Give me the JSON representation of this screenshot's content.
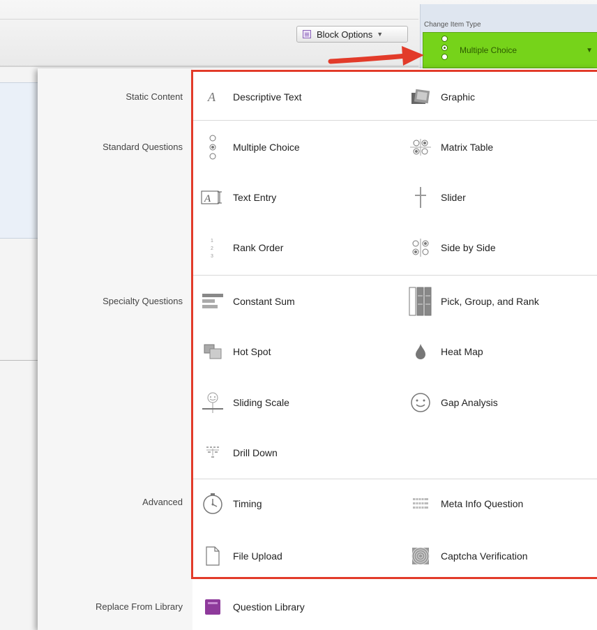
{
  "toolbar": {
    "block_options_label": "Block Options"
  },
  "change_item_type": {
    "label": "Change Item Type",
    "selected_value": "Multiple Choice",
    "accent_color": "#76d31a"
  },
  "categories": {
    "static": "Static Content",
    "standard": "Standard Questions",
    "specialty": "Specialty Questions",
    "advanced": "Advanced",
    "library": "Replace From Library"
  },
  "items": {
    "descriptive_text": {
      "label": "Descriptive Text",
      "icon": "descriptive-text-icon"
    },
    "graphic": {
      "label": "Graphic",
      "icon": "graphic-icon"
    },
    "multiple_choice": {
      "label": "Multiple Choice",
      "icon": "multiple-choice-icon"
    },
    "matrix_table": {
      "label": "Matrix Table",
      "icon": "matrix-table-icon"
    },
    "text_entry": {
      "label": "Text Entry",
      "icon": "text-entry-icon"
    },
    "slider": {
      "label": "Slider",
      "icon": "slider-icon"
    },
    "rank_order": {
      "label": "Rank Order",
      "icon": "rank-order-icon"
    },
    "side_by_side": {
      "label": "Side by Side",
      "icon": "side-by-side-icon"
    },
    "constant_sum": {
      "label": "Constant Sum",
      "icon": "constant-sum-icon"
    },
    "pick_group_rank": {
      "label": "Pick, Group, and Rank",
      "icon": "pick-group-rank-icon"
    },
    "hot_spot": {
      "label": "Hot Spot",
      "icon": "hot-spot-icon"
    },
    "heat_map": {
      "label": "Heat Map",
      "icon": "heat-map-icon"
    },
    "sliding_scale": {
      "label": "Sliding Scale",
      "icon": "sliding-scale-icon"
    },
    "gap_analysis": {
      "label": "Gap Analysis",
      "icon": "gap-analysis-icon"
    },
    "drill_down": {
      "label": "Drill Down",
      "icon": "drill-down-icon"
    },
    "timing": {
      "label": "Timing",
      "icon": "timing-icon"
    },
    "meta_info": {
      "label": "Meta Info Question",
      "icon": "meta-info-icon"
    },
    "file_upload": {
      "label": "File Upload",
      "icon": "file-upload-icon"
    },
    "captcha": {
      "label": "Captcha Verification",
      "icon": "captcha-icon"
    },
    "question_library": {
      "label": "Question Library",
      "icon": "question-library-icon"
    }
  },
  "colors": {
    "highlight_border": "#e23b2a",
    "arrow": "#e23b2a",
    "library_icon": "#8e3a9b"
  }
}
